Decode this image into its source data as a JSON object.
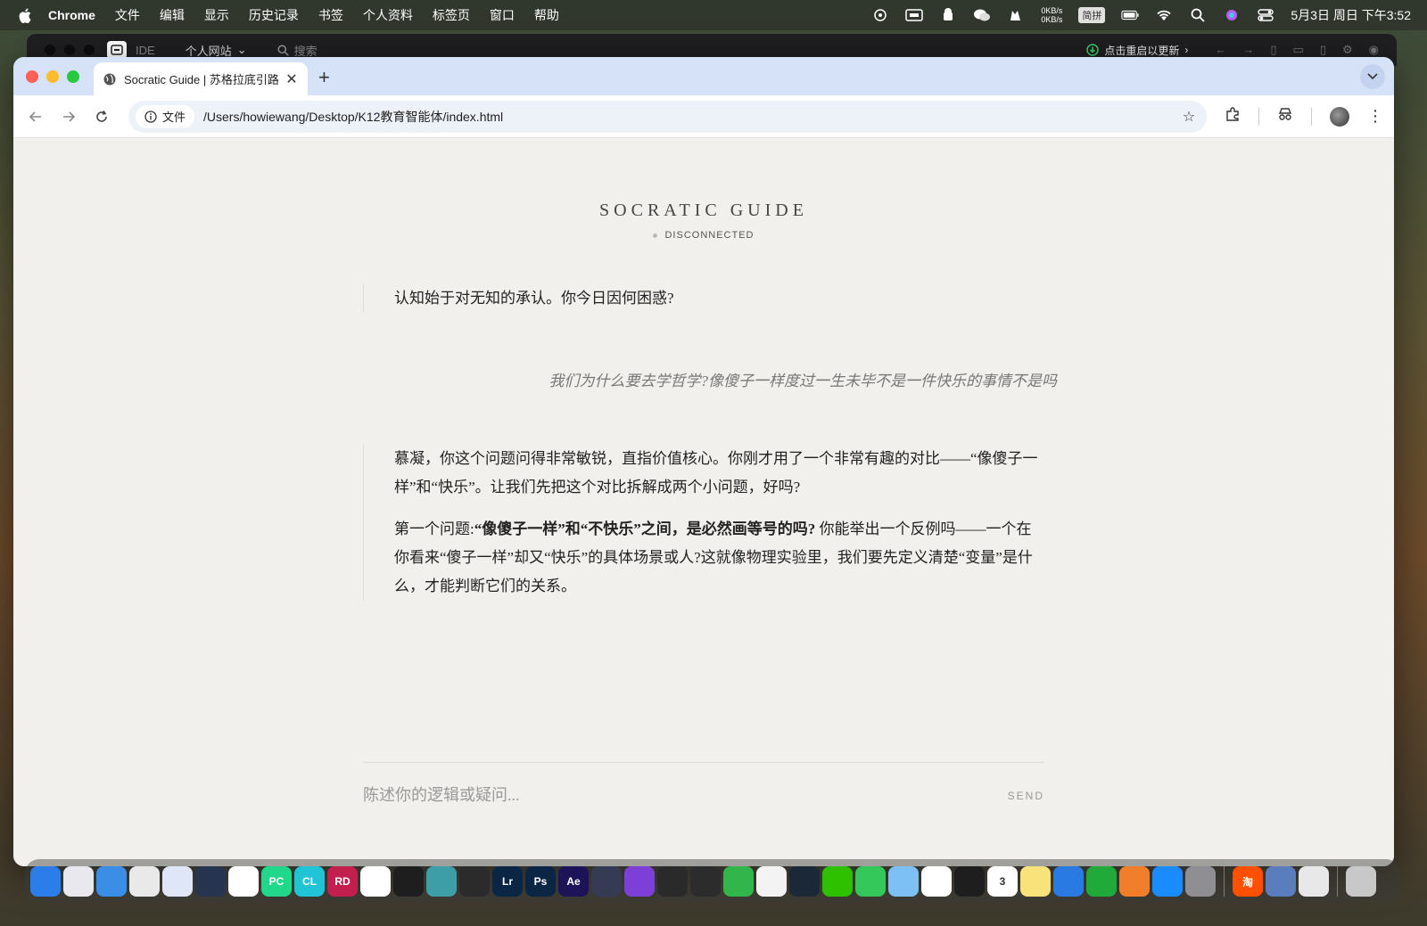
{
  "menubar": {
    "app": "Chrome",
    "items": [
      "文件",
      "编辑",
      "显示",
      "历史记录",
      "书签",
      "个人资料",
      "标签页",
      "窗口",
      "帮助"
    ],
    "netspeed_up": "0KB/s",
    "netspeed_down": "0KB/s",
    "ime": "简拼",
    "clock": "5月3日 周日 下午3:52"
  },
  "ide": {
    "label": "IDE",
    "project": "个人网站",
    "search": "搜索",
    "update": "点击重启以更新"
  },
  "browser": {
    "tab_title": "Socratic Guide | 苏格拉底引路",
    "url_chip": "文件",
    "url": "/Users/howiewang/Desktop/K12教育智能体/index.html"
  },
  "app": {
    "brand": "SOCRATIC GUIDE",
    "status": "DISCONNECTED",
    "messages": {
      "ai_greeting": "认知始于对无知的承认。你今日因何困惑?",
      "user_question": "我们为什么要去学哲学?像傻子一样度过一生未毕不是一件快乐的事情不是吗",
      "ai_reply_p1": "慕凝，你这个问题问得非常敏锐，直指价值核心。你刚才用了一个非常有趣的对比——“像傻子一样”和“快乐”。让我们先把这个对比拆解成两个小问题，好吗?",
      "ai_reply_p2_prefix": "第一个问题:",
      "ai_reply_p2_bold": "“像傻子一样”和“不快乐”之间，是必然画等号的吗?",
      "ai_reply_p2_rest": " 你能举出一个反例吗——一个在你看来“傻子一样”却又“快乐”的具体场景或人?这就像物理实验里，我们要先定义清楚“变量”是什么，才能判断它们的关系。"
    },
    "composer": {
      "placeholder": "陈述你的逻辑或疑问...",
      "send": "SEND"
    }
  },
  "dock": {
    "apps": [
      {
        "name": "finder",
        "label": "",
        "color": "#2b7de9"
      },
      {
        "name": "launchpad",
        "label": "",
        "color": "#e8e8ee"
      },
      {
        "name": "safari",
        "label": "",
        "color": "#3a8ee6"
      },
      {
        "name": "chrome",
        "label": "",
        "color": "#e9e9e9"
      },
      {
        "name": "gemini",
        "label": "",
        "color": "#dfe6f7"
      },
      {
        "name": "telegram-like",
        "label": "",
        "color": "#26344f"
      },
      {
        "name": "chatgpt",
        "label": "",
        "color": "#ffffff"
      },
      {
        "name": "pycharm",
        "label": "PC",
        "color": "#21d789"
      },
      {
        "name": "clion",
        "label": "CL",
        "color": "#21c4d7"
      },
      {
        "name": "rider",
        "label": "RD",
        "color": "#c21f4f"
      },
      {
        "name": "vscode",
        "label": "",
        "color": "#ffffff"
      },
      {
        "name": "terminal-ide",
        "label": "",
        "color": "#1e1e1e"
      },
      {
        "name": "arduino",
        "label": "",
        "color": "#3e9ea8"
      },
      {
        "name": "terminal",
        "label": "",
        "color": "#2b2b2b"
      },
      {
        "name": "lightroom",
        "label": "Lr",
        "color": "#0b2545"
      },
      {
        "name": "photoshop",
        "label": "Ps",
        "color": "#0b2545"
      },
      {
        "name": "after-effects",
        "label": "Ae",
        "color": "#1c1359"
      },
      {
        "name": "davinci",
        "label": "",
        "color": "#343b52"
      },
      {
        "name": "keynote-like",
        "label": "",
        "color": "#7c3fd8"
      },
      {
        "name": "final-cut",
        "label": "",
        "color": "#2a2a2a"
      },
      {
        "name": "blender",
        "label": "",
        "color": "#2c2c2c"
      },
      {
        "name": "numbers-green",
        "label": "",
        "color": "#32b54a"
      },
      {
        "name": "mail-like",
        "label": "",
        "color": "#f3f3f3"
      },
      {
        "name": "steam",
        "label": "",
        "color": "#1b2838"
      },
      {
        "name": "wechat",
        "label": "",
        "color": "#2dc100"
      },
      {
        "name": "messages",
        "label": "",
        "color": "#34c759"
      },
      {
        "name": "maps",
        "label": "",
        "color": "#7cc0f5"
      },
      {
        "name": "photos",
        "label": "",
        "color": "#ffffff"
      },
      {
        "name": "activity-monitor",
        "label": "",
        "color": "#1e1e1e"
      },
      {
        "name": "calendar",
        "label": "3",
        "color": "#ffffff"
      },
      {
        "name": "notes",
        "label": "",
        "color": "#f8e27a"
      },
      {
        "name": "keynote",
        "label": "",
        "color": "#2a7ae4"
      },
      {
        "name": "numbers",
        "label": "",
        "color": "#1faa3a"
      },
      {
        "name": "pages",
        "label": "",
        "color": "#f07e2b"
      },
      {
        "name": "app-store",
        "label": "",
        "color": "#1a8cff"
      },
      {
        "name": "system-settings",
        "label": "",
        "color": "#8e8e93"
      },
      {
        "name": "taobao",
        "label": "淘",
        "color": "#ff5000"
      },
      {
        "name": "disk-utility",
        "label": "",
        "color": "#5a7dbd"
      },
      {
        "name": "preview",
        "label": "",
        "color": "#e8e8e8"
      },
      {
        "name": "trash",
        "label": "",
        "color": "#c8c8c8"
      }
    ]
  }
}
